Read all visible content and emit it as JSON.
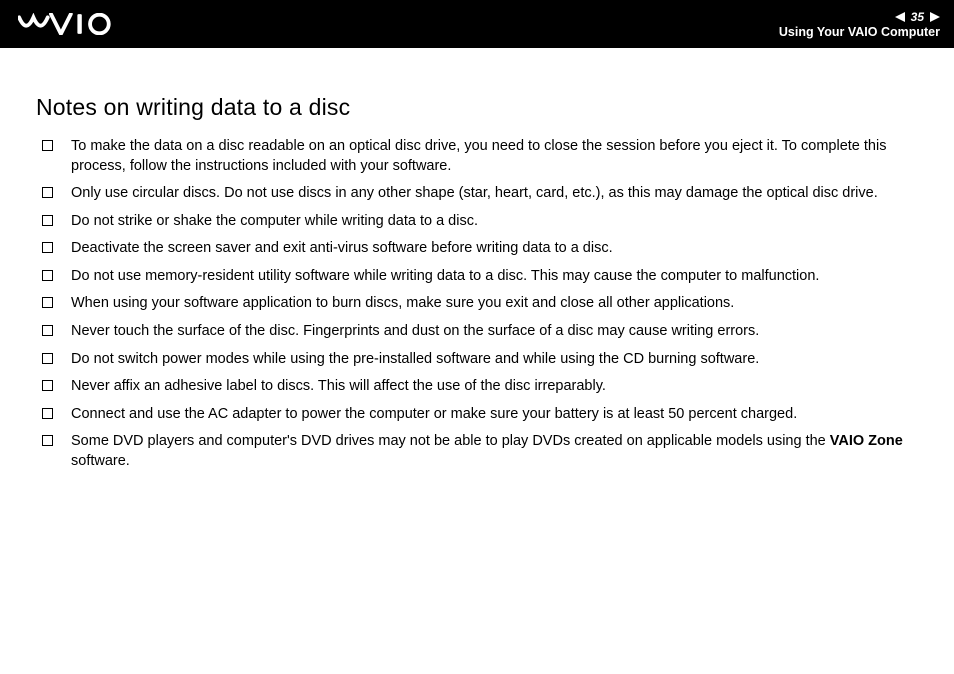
{
  "header": {
    "page_number": "35",
    "section": "Using Your VAIO Computer"
  },
  "content": {
    "heading": "Notes on writing data to a disc",
    "items": [
      {
        "text": "To make the data on a disc readable on an optical disc drive, you need to close the session before you eject it. To complete this process, follow the instructions included with your software."
      },
      {
        "text": "Only use circular discs. Do not use discs in any other shape (star, heart, card, etc.), as this may damage the optical disc drive."
      },
      {
        "text": "Do not strike or shake the computer while writing data to a disc."
      },
      {
        "text": "Deactivate the screen saver and exit anti-virus software before writing data to a disc."
      },
      {
        "text": "Do not use memory-resident utility software while writing data to a disc. This may cause the computer to malfunction."
      },
      {
        "text": "When using your software application to burn discs, make sure you exit and close all other applications."
      },
      {
        "text": "Never touch the surface of the disc. Fingerprints and dust on the surface of a disc may cause writing errors."
      },
      {
        "text": "Do not switch power modes while using the pre-installed software and while using the CD burning software."
      },
      {
        "text": "Never affix an adhesive label to discs. This will affect the use of the disc irreparably."
      },
      {
        "text": "Connect and use the AC adapter to power the computer or make sure your battery is at least 50 percent charged."
      },
      {
        "prefix": "Some DVD players and computer's DVD drives may not be able to play DVDs created on applicable models using the ",
        "bold": "VAIO Zone",
        "suffix": " software."
      }
    ]
  }
}
